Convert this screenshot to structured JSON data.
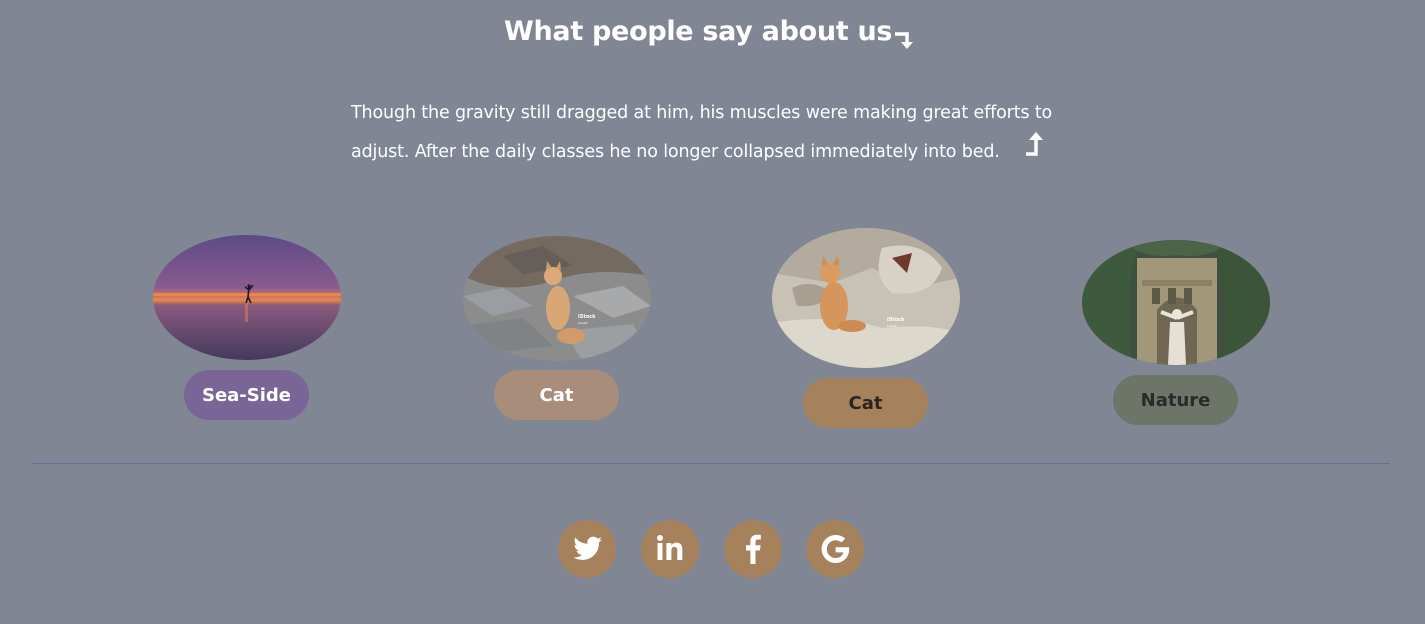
{
  "section": {
    "heading": "What people say about us",
    "quote": "Though the gravity still dragged at him, his muscles were making great efforts to adjust. After the daily classes he no longer collapsed immediately into bed."
  },
  "icons": {
    "heading_arrow": "down-right-arrow-icon",
    "quote_arrow": "up-arrow-icon"
  },
  "gallery": [
    {
      "label": "Sea-Side",
      "image": "sunset-beach-photo",
      "tag_color": "#7a6696",
      "text_color": "#ffffff"
    },
    {
      "label": "Cat",
      "image": "cat-on-rocks-photo",
      "tag_color": "#a88e7a",
      "text_color": "#ffffff"
    },
    {
      "label": "Cat",
      "image": "cat-on-stone-wall-photo",
      "tag_color": "#a6825c",
      "text_color": "#2a2522"
    },
    {
      "label": "Nature",
      "image": "overgrown-arch-statue-photo",
      "tag_color": "#6d7468",
      "text_color": "#2a2a2a"
    }
  ],
  "photo_overlay": {
    "watermark": "iStock",
    "credit": "Credit: "
  },
  "social": [
    {
      "name": "twitter",
      "icon": "twitter-icon"
    },
    {
      "name": "linkedin",
      "icon": "linkedin-icon"
    },
    {
      "name": "facebook",
      "icon": "facebook-icon"
    },
    {
      "name": "google",
      "icon": "google-icon"
    }
  ],
  "colors": {
    "background": "#808694",
    "divider": "#6e6a93",
    "social_circle": "#a6825c"
  }
}
